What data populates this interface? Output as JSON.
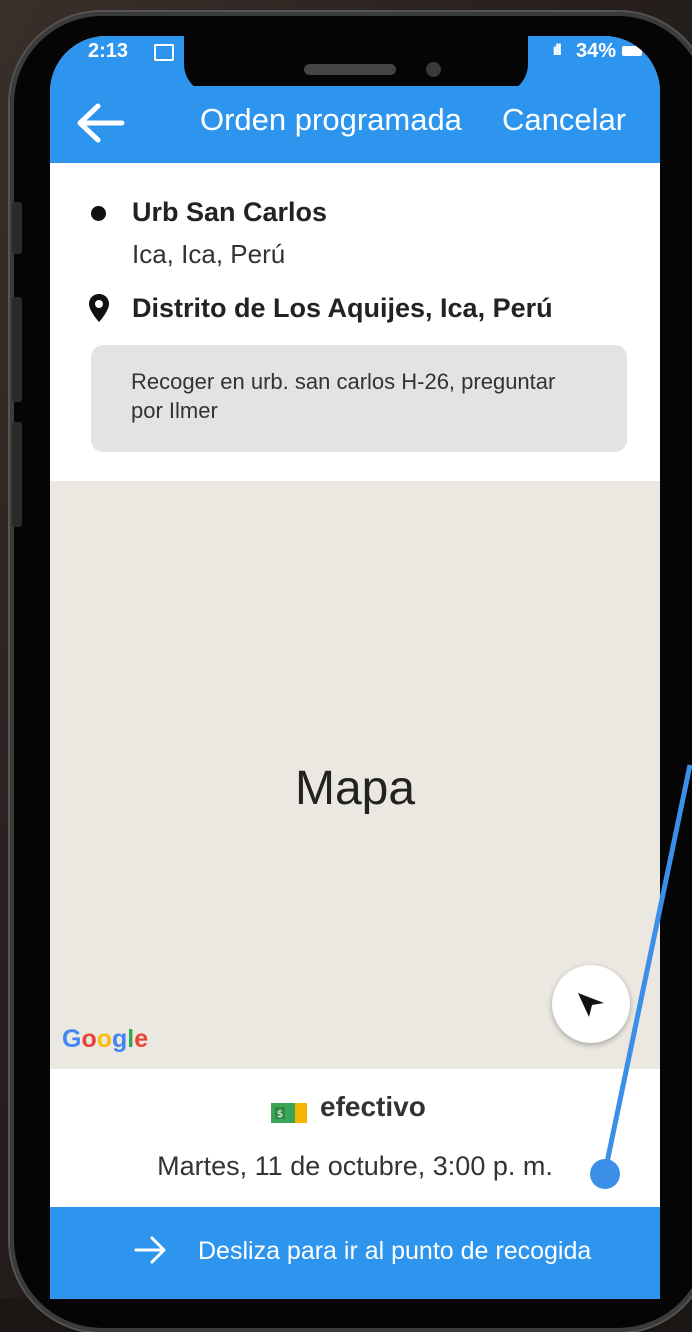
{
  "status_bar": {
    "time": "2:13",
    "battery": "34%"
  },
  "appbar": {
    "title": "Orden programada",
    "cancel_label": "Cancelar"
  },
  "route": {
    "origin_name": "Urb San Carlos",
    "origin_sub": "Ica, Ica, Perú",
    "destination_name": "Distrito de Los Aquijes, Ica, Perú",
    "note": "Recoger en urb. san carlos H-26, preguntar por Ilmer"
  },
  "map": {
    "label": "Mapa",
    "logo": "Google"
  },
  "order": {
    "payment_method": "efectivo",
    "payment_icon": "money-icon",
    "schedule": "Martes, 11 de octubre, 3:00 p. m."
  },
  "slide": {
    "label": "Desliza para ir al punto de recogida"
  },
  "colors": {
    "accent": "#2d95ee",
    "map_bg": "#ebe8e1",
    "annotation": "#3b8fe8"
  }
}
